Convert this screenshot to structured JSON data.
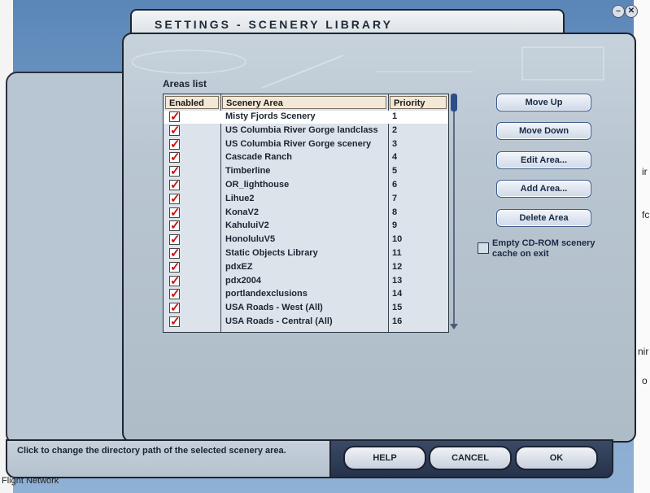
{
  "window": {
    "title": "SETTINGS - SCENERY LIBRARY",
    "minimize_glyph": "–",
    "close_glyph": "✕"
  },
  "background": {
    "right_snippets": [
      "ir",
      "fc",
      "nir",
      "o"
    ],
    "bottom_text": "Flight Network"
  },
  "areas_list": {
    "label": "Areas list",
    "columns": [
      "Enabled",
      "Scenery Area",
      "Priority"
    ],
    "rows": [
      {
        "name": "Misty Fjords Scenery",
        "priority": "1",
        "enabled": true
      },
      {
        "name": "US Columbia River Gorge landclass",
        "priority": "2",
        "enabled": true
      },
      {
        "name": "US Columbia River Gorge scenery",
        "priority": "3",
        "enabled": true
      },
      {
        "name": "Cascade Ranch",
        "priority": "4",
        "enabled": true
      },
      {
        "name": "Timberline",
        "priority": "5",
        "enabled": true
      },
      {
        "name": "OR_lighthouse",
        "priority": "6",
        "enabled": true
      },
      {
        "name": "Lihue2",
        "priority": "7",
        "enabled": true
      },
      {
        "name": "KonaV2",
        "priority": "8",
        "enabled": true
      },
      {
        "name": "KahuluiV2",
        "priority": "9",
        "enabled": true
      },
      {
        "name": "HonoluluV5",
        "priority": "10",
        "enabled": true
      },
      {
        "name": "Static Objects Library",
        "priority": "11",
        "enabled": true
      },
      {
        "name": "pdxEZ",
        "priority": "12",
        "enabled": true
      },
      {
        "name": "pdx2004",
        "priority": "13",
        "enabled": true
      },
      {
        "name": "portlandexclusions",
        "priority": "14",
        "enabled": true
      },
      {
        "name": "USA Roads - West (All)",
        "priority": "15",
        "enabled": true
      },
      {
        "name": "USA Roads - Central (All)",
        "priority": "16",
        "enabled": true
      }
    ],
    "check_glyph": "✓"
  },
  "actions": {
    "move_up": "Move Up",
    "move_down": "Move Down",
    "edit_area": "Edit Area...",
    "add_area": "Add Area...",
    "delete_area": "Delete Area",
    "empty_cache": "Empty CD-ROM scenery cache on exit"
  },
  "status": {
    "text": "Click to change the directory path of the selected scenery area."
  },
  "footer": {
    "help": "HELP",
    "cancel": "CANCEL",
    "ok": "OK"
  }
}
